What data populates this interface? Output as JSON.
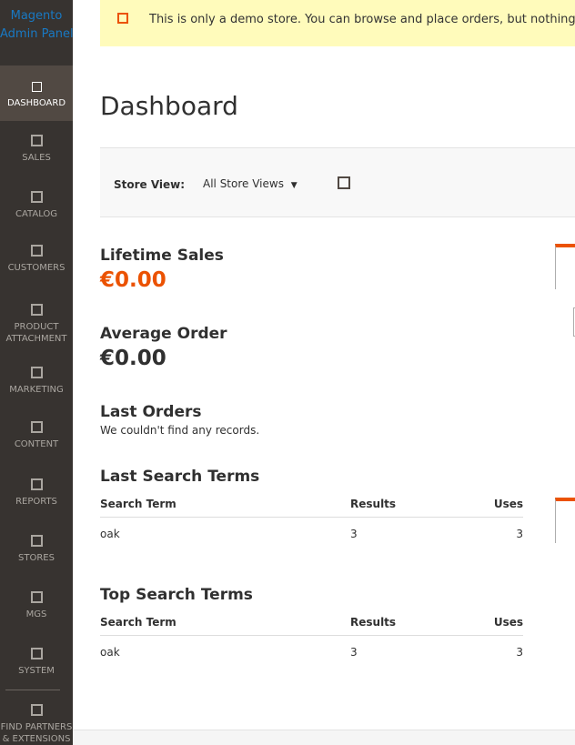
{
  "sidebar": {
    "logo_line1": "Magento",
    "logo_line2": "Admin Panel",
    "items": [
      {
        "label": "DASHBOARD",
        "icon": "dashboard-icon",
        "active": true
      },
      {
        "label": "SALES",
        "icon": "sales-icon"
      },
      {
        "label": "CATALOG",
        "icon": "catalog-icon"
      },
      {
        "label": "CUSTOMERS",
        "icon": "customers-icon"
      },
      {
        "label": "PRODUCT",
        "label2": "ATTACHMENT",
        "icon": "attachment-icon"
      },
      {
        "label": "MARKETING",
        "icon": "marketing-icon"
      },
      {
        "label": "CONTENT",
        "icon": "content-icon"
      },
      {
        "label": "REPORTS",
        "icon": "reports-icon"
      },
      {
        "label": "STORES",
        "icon": "stores-icon"
      },
      {
        "label": "MGS",
        "icon": "mgs-icon"
      },
      {
        "label": "SYSTEM",
        "icon": "system-icon"
      },
      {
        "label": "FIND PARTNERS",
        "label2": "& EXTENSIONS",
        "icon": "partners-icon"
      }
    ]
  },
  "notice": {
    "text": "This is only a demo store. You can browse and place orders, but nothing"
  },
  "page_title": "Dashboard",
  "store_view": {
    "label": "Store View:",
    "value": "All Store Views"
  },
  "lifetime_sales": {
    "label": "Lifetime Sales",
    "value": "€0.00"
  },
  "average_order": {
    "label": "Average Order",
    "value": "€0.00"
  },
  "last_orders": {
    "label": "Last Orders",
    "empty": "We couldn't find any records."
  },
  "last_search": {
    "title": "Last Search Terms",
    "headers": [
      "Search Term",
      "Results",
      "Uses"
    ],
    "rows": [
      [
        "oak",
        "3",
        "3"
      ]
    ]
  },
  "top_search": {
    "title": "Top Search Terms",
    "headers": [
      "Search Term",
      "Results",
      "Uses"
    ],
    "rows": [
      [
        "oak",
        "3",
        "3"
      ]
    ]
  },
  "colors": {
    "accent": "#eb5202",
    "sidebar": "#373330",
    "logo": "#1979c3",
    "notice": "#fffbbb"
  }
}
